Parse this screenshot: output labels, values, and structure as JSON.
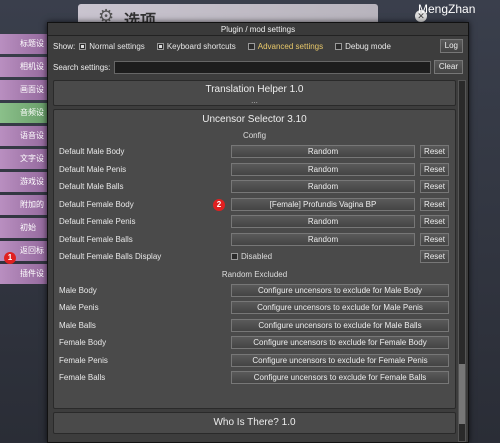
{
  "watermark": "MengZhan",
  "background": {
    "title": "选项",
    "menu": [
      {
        "label": "标题设"
      },
      {
        "label": "相机设"
      },
      {
        "label": "画面设"
      },
      {
        "label": "音频设"
      },
      {
        "label": "语音设"
      },
      {
        "label": "文字设"
      },
      {
        "label": "游戏设"
      },
      {
        "label": "附加的"
      },
      {
        "label": "初始"
      },
      {
        "label": "返回标"
      },
      {
        "label": "插件设"
      }
    ],
    "badge1": "1"
  },
  "window": {
    "title": "Plugin / mod settings",
    "toolbar": {
      "show_label": "Show:",
      "toggles": [
        {
          "label": "Normal settings",
          "checked": true
        },
        {
          "label": "Keyboard shortcuts",
          "checked": true
        },
        {
          "label": "Advanced settings",
          "checked": false
        },
        {
          "label": "Debug mode",
          "checked": false
        }
      ],
      "log_label": "Log"
    },
    "search": {
      "label": "Search settings:",
      "value": "",
      "clear_label": "Clear"
    },
    "plugins": {
      "translation": {
        "title": "Translation Helper 1.0",
        "dots": "..."
      },
      "uncensor": {
        "title": "Uncensor Selector 3.10",
        "config_title": "Config",
        "reset_label": "Reset",
        "settings": [
          {
            "name": "Default Male Body",
            "value": "Random"
          },
          {
            "name": "Default Male Penis",
            "value": "Random"
          },
          {
            "name": "Default Male Balls",
            "value": "Random"
          },
          {
            "name": "Default Female Body",
            "value": "[Female] Profundis Vagina BP"
          },
          {
            "name": "Default Female Penis",
            "value": "Random"
          },
          {
            "name": "Default Female Balls",
            "value": "Random"
          }
        ],
        "balls_display": {
          "name": "Default Female Balls Display",
          "value": "Disabled"
        },
        "badge2": "2",
        "random_excluded_title": "Random Excluded",
        "excluded": [
          {
            "name": "Male Body",
            "button": "Configure uncensors to exclude for Male Body"
          },
          {
            "name": "Male Penis",
            "button": "Configure uncensors to exclude for Male Penis"
          },
          {
            "name": "Male Balls",
            "button": "Configure uncensors to exclude for Male Balls"
          },
          {
            "name": "Female Body",
            "button": "Configure uncensors to exclude for Female Body"
          },
          {
            "name": "Female Penis",
            "button": "Configure uncensors to exclude for Female Penis"
          },
          {
            "name": "Female Balls",
            "button": "Configure uncensors to exclude for Female Balls"
          }
        ]
      },
      "who": {
        "title": "Who Is There? 1.0"
      }
    }
  }
}
